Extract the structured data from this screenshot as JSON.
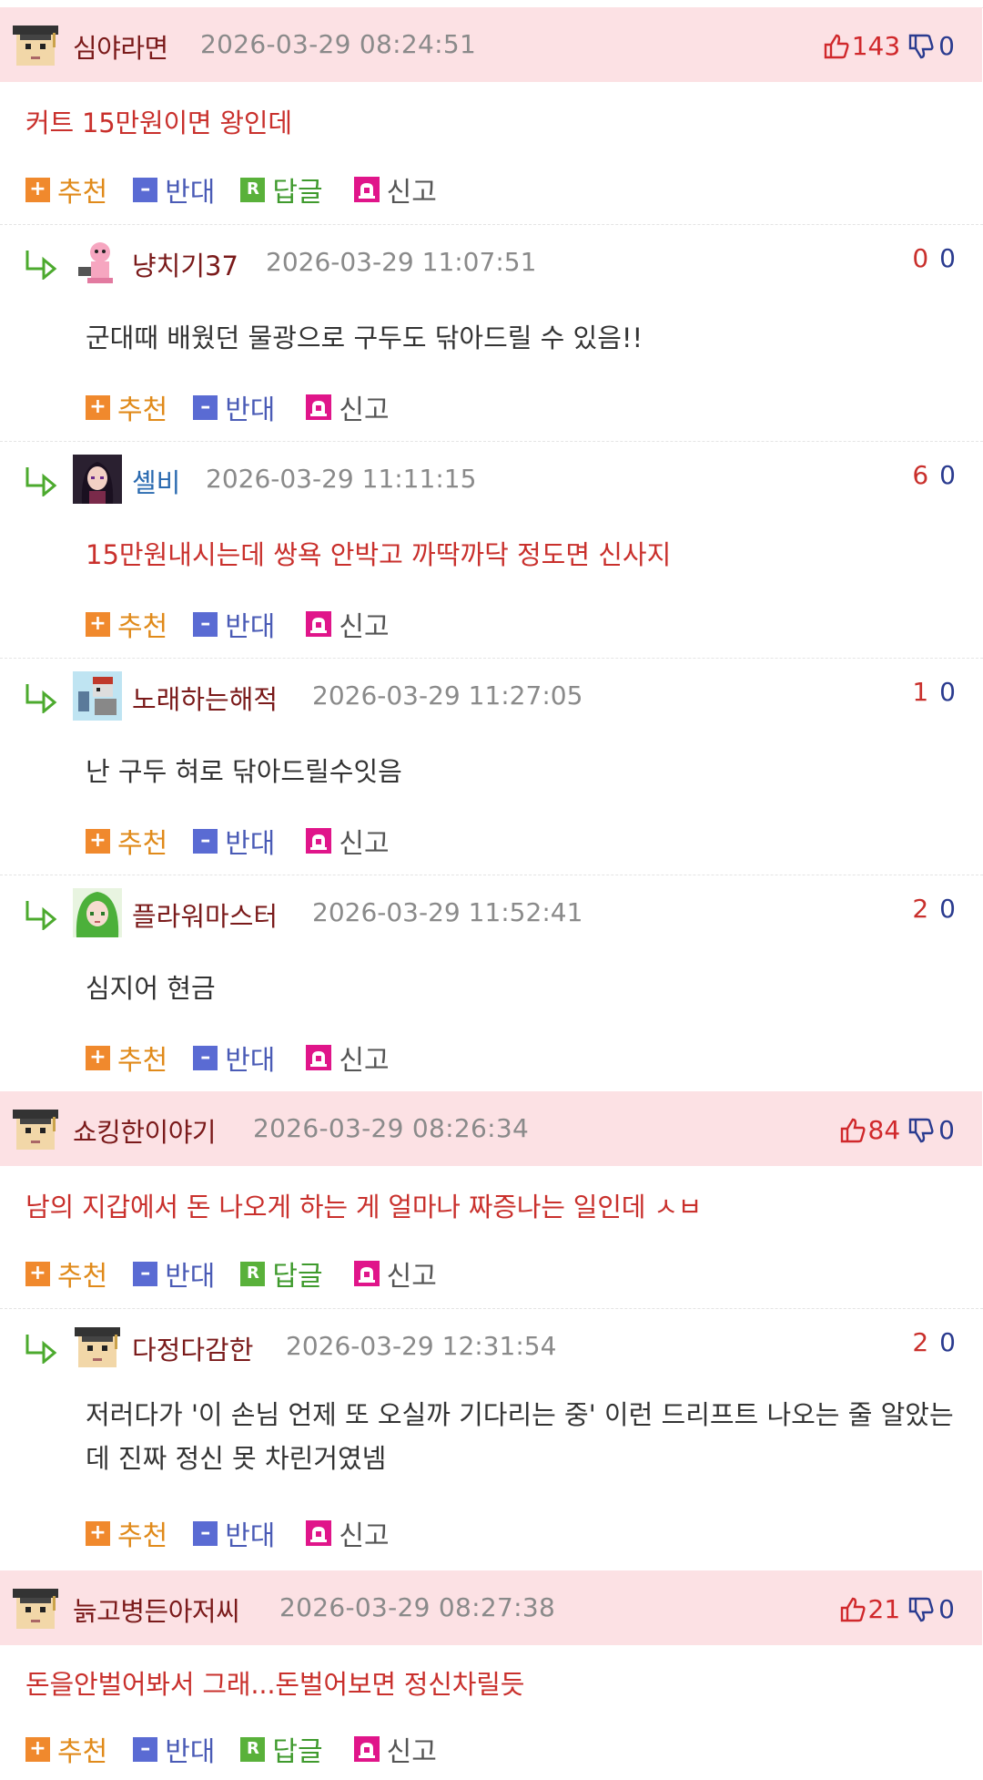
{
  "labels": {
    "recommend": "추천",
    "oppose": "반대",
    "reply": "답글",
    "report": "신고"
  },
  "comments": [
    {
      "nick": "심야라면",
      "time": "2026-03-29 08:24:51",
      "up": "143",
      "down": "0",
      "text": "커트 15만원이면 왕인데",
      "replies": [
        {
          "nick": "냥치기37",
          "time": "2026-03-29 11:07:51",
          "up": "0",
          "down": "0",
          "text": "군대때 배웠던 물광으로 구두도 닦아드릴 수 있음!!"
        },
        {
          "nick": "셸비",
          "time": "2026-03-29 11:11:15",
          "up": "6",
          "down": "0",
          "text": "15만원내시는데 쌍욕 안박고 까딱까닥 정도면 신사지"
        },
        {
          "nick": "노래하는해적",
          "time": "2026-03-29 11:27:05",
          "up": "1",
          "down": "0",
          "text": "난 구두 혀로 닦아드릴수잇음"
        },
        {
          "nick": "플라워마스터",
          "time": "2026-03-29 11:52:41",
          "up": "2",
          "down": "0",
          "text": "심지어 현금"
        }
      ]
    },
    {
      "nick": "쇼킹한이야기",
      "time": "2026-03-29 08:26:34",
      "up": "84",
      "down": "0",
      "text": "남의 지갑에서 돈 나오게 하는 게 얼마나 짜증나는 일인데 ㅅㅂ",
      "replies": [
        {
          "nick": "다정다감한",
          "time": "2026-03-29 12:31:54",
          "up": "2",
          "down": "0",
          "text": "저러다가 '이 손님 언제 또 오실까 기다리는 중' 이런 드리프트 나오는 줄 알았는데 진짜 정신 못 차린거였넴"
        }
      ]
    },
    {
      "nick": "늙고병든아저씨",
      "time": "2026-03-29 08:27:38",
      "up": "21",
      "down": "0",
      "text": "돈을안벌어봐서 그래...돈벌어보면 정신차릴듯",
      "replies": []
    }
  ]
}
